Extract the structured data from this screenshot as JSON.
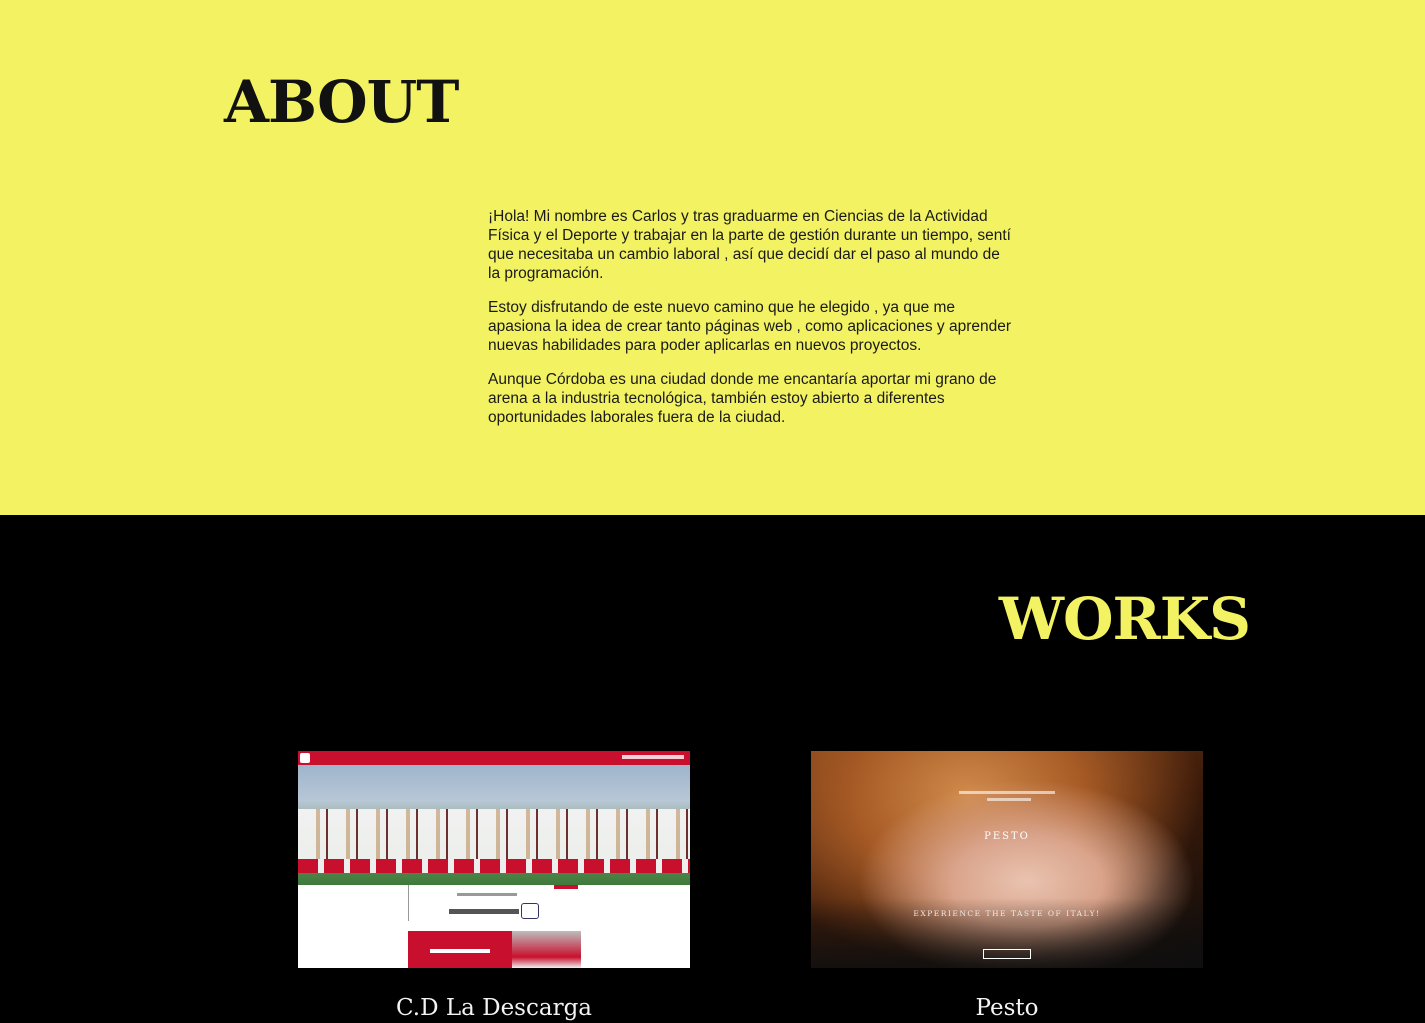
{
  "about": {
    "title": "ABOUT",
    "paragraphs": [
      "¡Hola! Mi nombre es Carlos y tras graduarme en Ciencias de la Actividad Física y el Deporte y trabajar en la parte de gestión durante un tiempo, sentí que necesitaba un cambio laboral , así que decidí dar el paso al mundo de la programación.",
      "Estoy disfrutando de este nuevo camino que he elegido , ya que me apasiona la idea de crear tanto páginas web , como aplicaciones y aprender nuevas habilidades para poder aplicarlas en nuevos proyectos.",
      "Aunque Córdoba es una ciudad donde me encantaría aportar mi grano de arena a la industria tecnológica, también estoy abierto a diferentes oportunidades laborales fuera de la ciudad."
    ]
  },
  "works": {
    "title": "WORKS",
    "projects": [
      {
        "title": "C.D La Descarga"
      },
      {
        "title": "Pesto",
        "logo": "PESTO",
        "tagline": "EXPERIENCE THE TASTE OF ITALY!"
      }
    ]
  },
  "colors": {
    "accent": "#f2f263",
    "background": "#000000",
    "club_red": "#c8102e"
  }
}
